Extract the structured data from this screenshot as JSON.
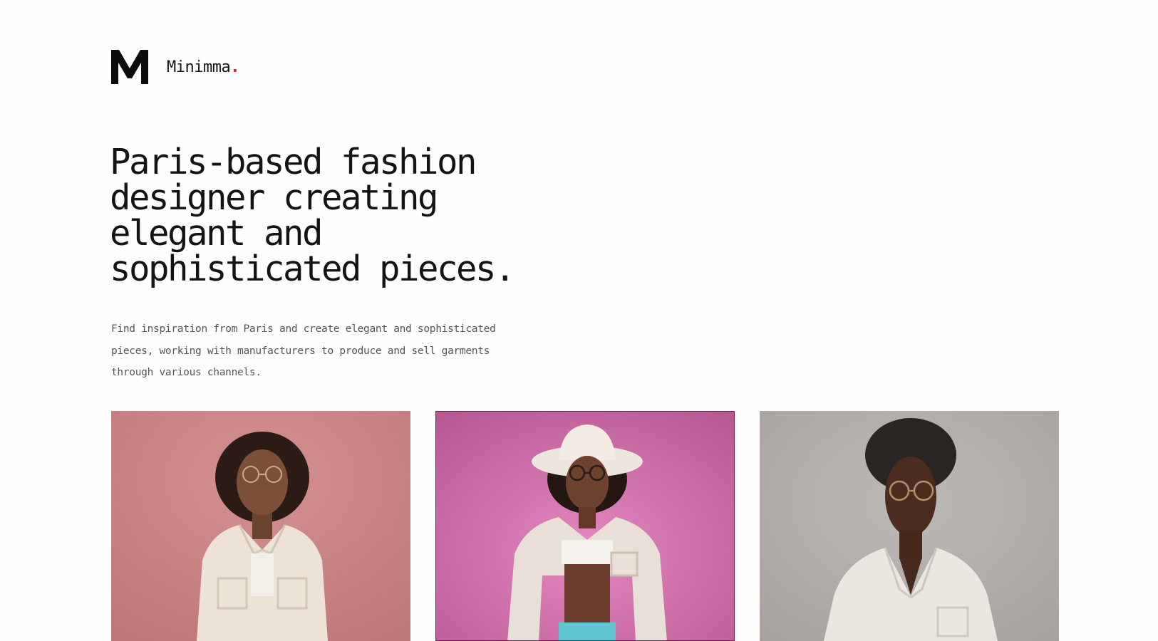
{
  "brand": {
    "logo_letter": "M",
    "name": "Minimma",
    "dot": ".",
    "dot_color": "#d0202a"
  },
  "hero": {
    "headline_lines": [
      "Paris-based fashion",
      "designer creating",
      "elegant and",
      "sophisticated pieces."
    ],
    "description_lines": [
      "Find inspiration from Paris and create elegant and sophisticated",
      "pieces, working with manufacturers to produce and sell garments",
      "through various channels."
    ]
  },
  "gallery": {
    "cards": [
      {
        "subject": "model in cream jacket on pink background",
        "bg_color": "#c88282"
      },
      {
        "subject": "model in white hat and cream jacket on magenta background",
        "bg_color": "#c96aa6"
      },
      {
        "subject": "model in cream shirt on grey background",
        "bg_color": "#b4afac"
      }
    ]
  }
}
